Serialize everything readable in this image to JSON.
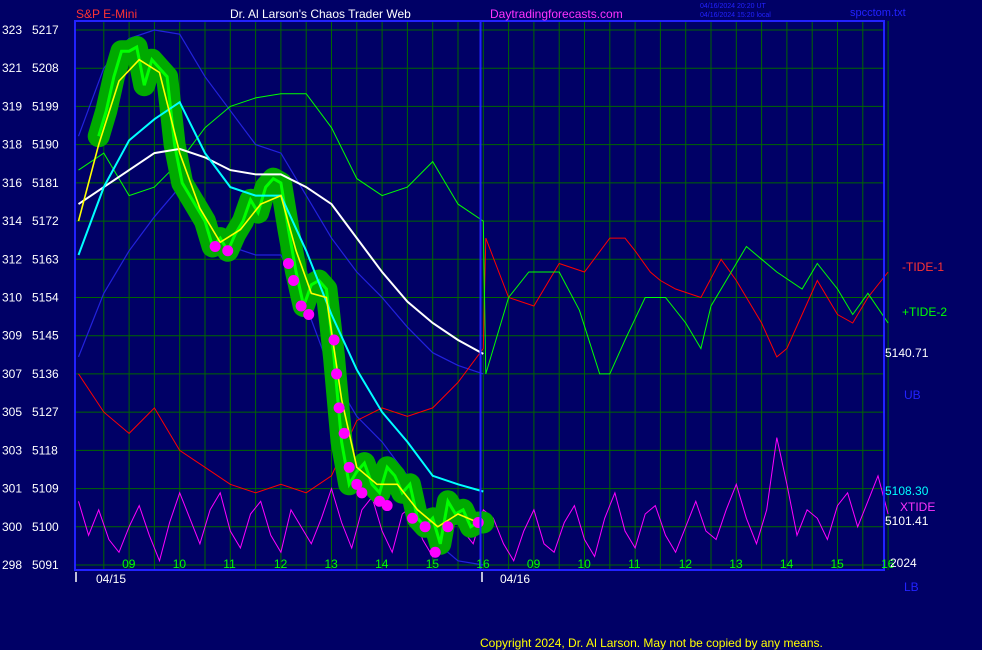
{
  "header": {
    "instrument": "S&P E-Mini",
    "site": "Dr. Al Larson's Chaos Trader Web",
    "link": "Daytradingforecasts.com",
    "ts_ut": "04/16/2024 20:20 UT",
    "ts_local": "04/16/2024 15:20 local",
    "file": "spcctom.txt"
  },
  "copyright": "Copyright 2024, Dr. Al Larson. May not be copied by any means.",
  "colors": {
    "background": "#000066",
    "grid": "#006600",
    "axis": "#2222ff",
    "price": "#00ff00",
    "price_glow": "#00aa00",
    "ema_fast": "#ffff00",
    "ema_mid": "#00ffff",
    "ema_slow": "#ffffff",
    "band": "#2222dd",
    "tide1": "#ff0000",
    "tide2": "#00ff00",
    "xtide": "#ff00ff",
    "title_red": "#ff3333",
    "title_white": "#ffffff",
    "title_magenta": "#ff33ff"
  },
  "chart_data": {
    "type": "line",
    "title": "S&P E-Mini",
    "y_left_ticks": [
      {
        "a": "323",
        "b": "5217"
      },
      {
        "a": "321",
        "b": "5208"
      },
      {
        "a": "319",
        "b": "5199"
      },
      {
        "a": "318",
        "b": "5190"
      },
      {
        "a": "316",
        "b": "5181"
      },
      {
        "a": "314",
        "b": "5172"
      },
      {
        "a": "312",
        "b": "5163"
      },
      {
        "a": "310",
        "b": "5154"
      },
      {
        "a": "309",
        "b": "5145"
      },
      {
        "a": "307",
        "b": "5136"
      },
      {
        "a": "305",
        "b": "5127"
      },
      {
        "a": "303",
        "b": "5118"
      },
      {
        "a": "301",
        "b": "5109"
      },
      {
        "a": "300",
        "b": "5100"
      },
      {
        "a": "298",
        "b": "5091"
      }
    ],
    "ylim": [
      5091,
      5217
    ],
    "x_ticks_day1": [
      "09",
      "10",
      "11",
      "12",
      "13",
      "14",
      "15",
      "16"
    ],
    "x_ticks_day2": [
      "09",
      "10",
      "11",
      "12",
      "13",
      "14",
      "15",
      "16"
    ],
    "date_labels": [
      "04/15",
      "04/16"
    ],
    "year_label": "2024",
    "right_labels": {
      "tide1": "-TIDE-1",
      "tide2": "+TIDE-2",
      "ema_slow_last": "5140.71",
      "ub": "UB",
      "ema_mid_last": "5108.30",
      "xtide": "XTIDE",
      "last_price": "5101.41",
      "lb": "LB"
    },
    "price_points": [
      [
        8.4,
        5192
      ],
      [
        8.55,
        5198
      ],
      [
        8.7,
        5206
      ],
      [
        8.85,
        5212
      ],
      [
        9.0,
        5212
      ],
      [
        9.15,
        5213
      ],
      [
        9.3,
        5204
      ],
      [
        9.45,
        5210
      ],
      [
        9.6,
        5208
      ],
      [
        9.75,
        5206
      ],
      [
        9.9,
        5190
      ],
      [
        10.05,
        5181
      ],
      [
        10.2,
        5178
      ],
      [
        10.35,
        5175
      ],
      [
        10.5,
        5172
      ],
      [
        10.65,
        5166
      ],
      [
        10.8,
        5168
      ],
      [
        10.95,
        5165
      ],
      [
        11.1,
        5169
      ],
      [
        11.25,
        5172
      ],
      [
        11.4,
        5177
      ],
      [
        11.55,
        5174
      ],
      [
        11.7,
        5180
      ],
      [
        11.85,
        5182
      ],
      [
        12.0,
        5181
      ],
      [
        12.15,
        5170
      ],
      [
        12.3,
        5160
      ],
      [
        12.45,
        5152
      ],
      [
        12.6,
        5157
      ],
      [
        12.75,
        5158
      ],
      [
        12.9,
        5156
      ],
      [
        13.05,
        5140
      ],
      [
        13.2,
        5120
      ],
      [
        13.35,
        5110
      ],
      [
        13.5,
        5113
      ],
      [
        13.65,
        5115
      ],
      [
        13.8,
        5110
      ],
      [
        13.95,
        5108
      ],
      [
        14.1,
        5114
      ],
      [
        14.25,
        5112
      ],
      [
        14.4,
        5108
      ],
      [
        14.55,
        5110
      ],
      [
        14.7,
        5102
      ],
      [
        14.85,
        5100
      ],
      [
        15.0,
        5102
      ],
      [
        15.15,
        5096
      ],
      [
        15.3,
        5106
      ],
      [
        15.45,
        5103
      ],
      [
        15.6,
        5104
      ],
      [
        15.75,
        5100
      ],
      [
        15.9,
        5101
      ],
      [
        16.0,
        5101
      ]
    ],
    "sell_dots": [
      [
        10.7,
        5166
      ],
      [
        10.95,
        5165
      ],
      [
        12.15,
        5162
      ],
      [
        12.25,
        5158
      ],
      [
        12.4,
        5152
      ],
      [
        12.55,
        5150
      ],
      [
        13.05,
        5144
      ],
      [
        13.1,
        5136
      ],
      [
        13.15,
        5128
      ],
      [
        13.25,
        5122
      ],
      [
        13.35,
        5114
      ],
      [
        13.5,
        5110
      ],
      [
        13.6,
        5108
      ],
      [
        13.95,
        5106
      ],
      [
        14.1,
        5105
      ],
      [
        14.6,
        5102
      ],
      [
        14.85,
        5100
      ],
      [
        15.05,
        5094
      ],
      [
        15.3,
        5100
      ],
      [
        15.9,
        5101
      ]
    ],
    "ema_fast": [
      [
        8.0,
        5172
      ],
      [
        8.4,
        5190
      ],
      [
        8.8,
        5205
      ],
      [
        9.2,
        5210
      ],
      [
        9.6,
        5207
      ],
      [
        10.0,
        5188
      ],
      [
        10.4,
        5175
      ],
      [
        10.8,
        5167
      ],
      [
        11.2,
        5170
      ],
      [
        11.6,
        5176
      ],
      [
        12.0,
        5178
      ],
      [
        12.3,
        5165
      ],
      [
        12.6,
        5155
      ],
      [
        12.9,
        5154
      ],
      [
        13.2,
        5130
      ],
      [
        13.5,
        5114
      ],
      [
        13.9,
        5110
      ],
      [
        14.3,
        5110
      ],
      [
        14.7,
        5104
      ],
      [
        15.1,
        5100
      ],
      [
        15.5,
        5103
      ],
      [
        15.9,
        5101
      ]
    ],
    "ema_mid": [
      [
        8.0,
        5164
      ],
      [
        8.5,
        5180
      ],
      [
        9.0,
        5191
      ],
      [
        9.5,
        5196
      ],
      [
        10.0,
        5200
      ],
      [
        10.5,
        5188
      ],
      [
        11.0,
        5180
      ],
      [
        11.5,
        5178
      ],
      [
        12.0,
        5178
      ],
      [
        12.5,
        5165
      ],
      [
        13.0,
        5150
      ],
      [
        13.5,
        5137
      ],
      [
        14.0,
        5127
      ],
      [
        14.5,
        5120
      ],
      [
        15.0,
        5112
      ],
      [
        15.5,
        5110
      ],
      [
        16.0,
        5108.3
      ]
    ],
    "ema_slow": [
      [
        8.0,
        5176
      ],
      [
        8.5,
        5180
      ],
      [
        9.0,
        5184
      ],
      [
        9.5,
        5188
      ],
      [
        10.0,
        5189
      ],
      [
        10.5,
        5187
      ],
      [
        11.0,
        5184
      ],
      [
        11.5,
        5183
      ],
      [
        12.0,
        5183
      ],
      [
        12.5,
        5180
      ],
      [
        13.0,
        5176
      ],
      [
        13.5,
        5168
      ],
      [
        14.0,
        5160
      ],
      [
        14.5,
        5153
      ],
      [
        15.0,
        5148
      ],
      [
        15.5,
        5144
      ],
      [
        16.0,
        5140.71
      ]
    ],
    "ub": [
      [
        8.0,
        5192
      ],
      [
        8.5,
        5208
      ],
      [
        9.0,
        5215
      ],
      [
        9.5,
        5217
      ],
      [
        10.0,
        5216
      ],
      [
        10.5,
        5206
      ],
      [
        11.0,
        5198
      ],
      [
        11.5,
        5190
      ],
      [
        12.0,
        5188
      ],
      [
        12.5,
        5178
      ],
      [
        13.0,
        5168
      ],
      [
        13.5,
        5160
      ],
      [
        14.0,
        5154
      ],
      [
        14.5,
        5147
      ],
      [
        15.0,
        5141
      ],
      [
        15.5,
        5138
      ],
      [
        16.0,
        5136
      ]
    ],
    "lb": [
      [
        8.0,
        5140
      ],
      [
        8.5,
        5155
      ],
      [
        9.0,
        5165
      ],
      [
        9.5,
        5173
      ],
      [
        10.0,
        5180
      ],
      [
        10.5,
        5175
      ],
      [
        11.0,
        5166
      ],
      [
        11.5,
        5164
      ],
      [
        12.0,
        5164
      ],
      [
        12.5,
        5152
      ],
      [
        13.0,
        5136
      ],
      [
        13.5,
        5126
      ],
      [
        14.0,
        5120
      ],
      [
        14.5,
        5112
      ],
      [
        15.0,
        5097
      ],
      [
        15.5,
        5092
      ],
      [
        16.0,
        5091
      ]
    ],
    "tide1": [
      [
        8.0,
        5136
      ],
      [
        8.5,
        5127
      ],
      [
        9.0,
        5122
      ],
      [
        9.5,
        5128
      ],
      [
        10.0,
        5118
      ],
      [
        10.5,
        5114
      ],
      [
        11.0,
        5110
      ],
      [
        11.5,
        5108
      ],
      [
        12.0,
        5110
      ],
      [
        12.5,
        5108
      ],
      [
        13.0,
        5112
      ],
      [
        13.5,
        5125
      ],
      [
        14.0,
        5128
      ],
      [
        14.5,
        5126
      ],
      [
        15.0,
        5128
      ],
      [
        15.5,
        5134
      ],
      [
        16.0,
        5142
      ],
      [
        16.05,
        5168
      ],
      [
        16.5,
        5154
      ],
      [
        17.0,
        5152
      ],
      [
        17.5,
        5162
      ],
      [
        18.0,
        5160
      ],
      [
        18.5,
        5168
      ],
      [
        18.8,
        5168
      ],
      [
        19.0,
        5165
      ],
      [
        19.3,
        5160
      ],
      [
        19.5,
        5158
      ],
      [
        19.8,
        5156
      ],
      [
        20.3,
        5154
      ],
      [
        20.7,
        5163
      ],
      [
        21.0,
        5158
      ],
      [
        21.5,
        5148
      ],
      [
        21.8,
        5140
      ],
      [
        22.0,
        5142
      ],
      [
        22.3,
        5150
      ],
      [
        22.6,
        5158
      ],
      [
        23.0,
        5150
      ],
      [
        23.3,
        5148
      ],
      [
        23.6,
        5154
      ],
      [
        24.0,
        5160
      ]
    ],
    "tide2": [
      [
        8.0,
        5184
      ],
      [
        8.5,
        5188
      ],
      [
        9.0,
        5178
      ],
      [
        9.5,
        5180
      ],
      [
        10.0,
        5186
      ],
      [
        10.5,
        5194
      ],
      [
        11.0,
        5199
      ],
      [
        11.5,
        5201
      ],
      [
        12.0,
        5202
      ],
      [
        12.5,
        5202
      ],
      [
        13.0,
        5194
      ],
      [
        13.5,
        5182
      ],
      [
        14.0,
        5178
      ],
      [
        14.5,
        5180
      ],
      [
        15.0,
        5186
      ],
      [
        15.5,
        5176
      ],
      [
        16.0,
        5172
      ],
      [
        16.05,
        5136
      ],
      [
        16.5,
        5154
      ],
      [
        16.9,
        5160
      ],
      [
        17.5,
        5160
      ],
      [
        17.9,
        5151
      ],
      [
        18.3,
        5136
      ],
      [
        18.5,
        5136
      ],
      [
        18.8,
        5144
      ],
      [
        19.2,
        5154
      ],
      [
        19.6,
        5154
      ],
      [
        20.0,
        5148
      ],
      [
        20.3,
        5142
      ],
      [
        20.5,
        5152
      ],
      [
        20.8,
        5158
      ],
      [
        21.2,
        5166
      ],
      [
        21.8,
        5160
      ],
      [
        22.3,
        5156
      ],
      [
        22.6,
        5162
      ],
      [
        23.0,
        5156
      ],
      [
        23.3,
        5150
      ],
      [
        23.6,
        5155
      ],
      [
        24.0,
        5148
      ]
    ],
    "xtide": [
      [
        8.0,
        5106
      ],
      [
        8.2,
        5098
      ],
      [
        8.4,
        5104
      ],
      [
        8.6,
        5097
      ],
      [
        8.8,
        5094
      ],
      [
        9.0,
        5100
      ],
      [
        9.2,
        5105
      ],
      [
        9.4,
        5098
      ],
      [
        9.6,
        5092
      ],
      [
        9.8,
        5101
      ],
      [
        10.0,
        5108
      ],
      [
        10.2,
        5102
      ],
      [
        10.4,
        5096
      ],
      [
        10.6,
        5104
      ],
      [
        10.8,
        5108
      ],
      [
        11.0,
        5099
      ],
      [
        11.2,
        5095
      ],
      [
        11.4,
        5103
      ],
      [
        11.6,
        5106
      ],
      [
        11.8,
        5098
      ],
      [
        12.0,
        5094
      ],
      [
        12.2,
        5104
      ],
      [
        12.4,
        5100
      ],
      [
        12.6,
        5096
      ],
      [
        12.8,
        5102
      ],
      [
        13.0,
        5109
      ],
      [
        13.2,
        5101
      ],
      [
        13.4,
        5095
      ],
      [
        13.6,
        5104
      ],
      [
        13.8,
        5107
      ],
      [
        14.0,
        5099
      ],
      [
        14.2,
        5094
      ],
      [
        14.4,
        5103
      ],
      [
        14.6,
        5105
      ],
      [
        14.8,
        5097
      ],
      [
        15.0,
        5093
      ],
      [
        15.2,
        5101
      ],
      [
        15.4,
        5108
      ],
      [
        15.6,
        5099
      ],
      [
        15.8,
        5096
      ],
      [
        16.0,
        5104
      ],
      [
        16.2,
        5102
      ],
      [
        16.4,
        5096
      ],
      [
        16.6,
        5092
      ],
      [
        16.8,
        5099
      ],
      [
        17.0,
        5104
      ],
      [
        17.2,
        5096
      ],
      [
        17.4,
        5094
      ],
      [
        17.6,
        5101
      ],
      [
        17.8,
        5105
      ],
      [
        18.0,
        5097
      ],
      [
        18.2,
        5093
      ],
      [
        18.4,
        5102
      ],
      [
        18.6,
        5108
      ],
      [
        18.8,
        5099
      ],
      [
        19.0,
        5095
      ],
      [
        19.2,
        5103
      ],
      [
        19.4,
        5105
      ],
      [
        19.6,
        5098
      ],
      [
        19.8,
        5094
      ],
      [
        20.0,
        5100
      ],
      [
        20.2,
        5106
      ],
      [
        20.4,
        5099
      ],
      [
        20.6,
        5097
      ],
      [
        20.8,
        5104
      ],
      [
        21.0,
        5110
      ],
      [
        21.2,
        5102
      ],
      [
        21.4,
        5096
      ],
      [
        21.6,
        5104
      ],
      [
        21.8,
        5121
      ],
      [
        22.0,
        5110
      ],
      [
        22.2,
        5098
      ],
      [
        22.4,
        5104
      ],
      [
        22.6,
        5102
      ],
      [
        22.8,
        5097
      ],
      [
        23.0,
        5105
      ],
      [
        23.2,
        5108
      ],
      [
        23.4,
        5100
      ],
      [
        23.6,
        5106
      ],
      [
        23.8,
        5112
      ],
      [
        24.0,
        5103
      ]
    ]
  }
}
